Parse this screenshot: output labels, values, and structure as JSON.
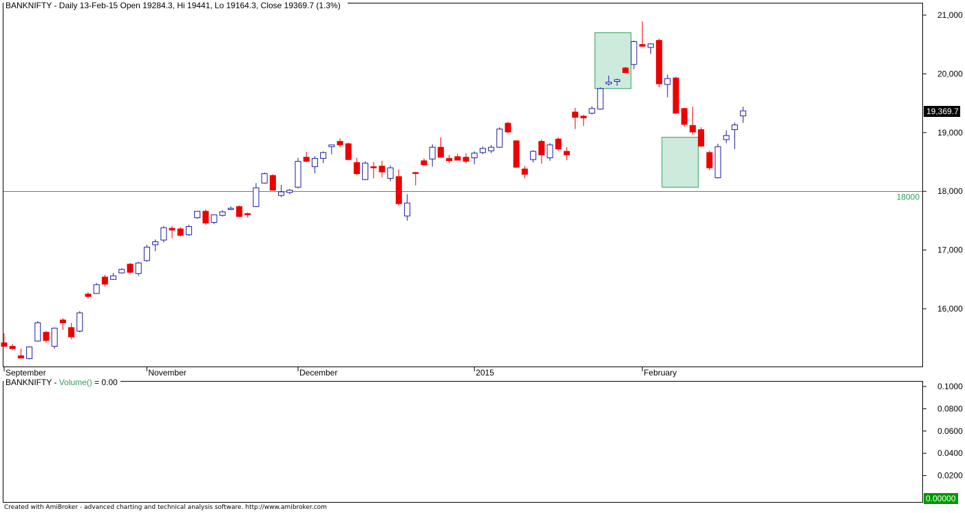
{
  "header": {
    "title": "BANKNIFTY - Daily 13-Feb-15 Open 19284.3, Hi 19441, Lo 19164.3, Close 19369.7 (1.3%)"
  },
  "volume_panel": {
    "label_prefix": "BANKNIFTY - ",
    "indicator": "Volume()",
    "value_text": " = 0.00",
    "last_value_badge": "0.00000"
  },
  "footer": {
    "text": "Created with AmiBroker - advanced charting and technical analysis software. http://www.amibroker.com"
  },
  "colors": {
    "up_candle_border": "#1a1aaa",
    "down_candle": "#ee0000",
    "highlight_box": "#cdebdc",
    "reference_line": "#2e9e5b",
    "last_price_badge_bg": "#000000",
    "volume_badge_bg": "#009900"
  },
  "chart_data": [
    {
      "type": "candlestick",
      "y_range": [
        15000,
        21100
      ],
      "y_ticks": [
        16000,
        17000,
        18000,
        19000,
        20000,
        21000
      ],
      "y_tick_labels": [
        "16,000",
        "17,000",
        "18,000",
        "19,000",
        "20,000",
        "21,000"
      ],
      "x_labels": [
        "September",
        "November",
        "December",
        "2015",
        "February"
      ],
      "x_label_index": [
        0,
        17,
        35,
        56,
        76
      ],
      "last_price_label": "19,369.7",
      "last_price": 19369.7,
      "reference_line": {
        "value": 18000,
        "label": "18000"
      },
      "highlight_boxes": [
        {
          "from_index": 71,
          "to_index": 74,
          "low": 19750,
          "high": 20700
        },
        {
          "from_index": 79,
          "to_index": 82,
          "low": 18070,
          "high": 18920
        }
      ],
      "candles": [
        {
          "o": 15420,
          "h": 15580,
          "l": 15370,
          "c": 15360
        },
        {
          "o": 15360,
          "h": 15400,
          "l": 15300,
          "c": 15320
        },
        {
          "o": 15200,
          "h": 15320,
          "l": 15180,
          "c": 15160
        },
        {
          "o": 15150,
          "h": 15360,
          "l": 15140,
          "c": 15350
        },
        {
          "o": 15450,
          "h": 15790,
          "l": 15440,
          "c": 15760
        },
        {
          "o": 15600,
          "h": 15620,
          "l": 15420,
          "c": 15460
        },
        {
          "o": 15360,
          "h": 15680,
          "l": 15320,
          "c": 15670
        },
        {
          "o": 15810,
          "h": 15840,
          "l": 15640,
          "c": 15760
        },
        {
          "o": 15680,
          "h": 15760,
          "l": 15480,
          "c": 15520
        },
        {
          "o": 15620,
          "h": 15960,
          "l": 15600,
          "c": 15930
        },
        {
          "o": 16250,
          "h": 16280,
          "l": 16180,
          "c": 16210
        },
        {
          "o": 16260,
          "h": 16440,
          "l": 16260,
          "c": 16410
        },
        {
          "o": 16540,
          "h": 16580,
          "l": 16380,
          "c": 16420
        },
        {
          "o": 16500,
          "h": 16610,
          "l": 16490,
          "c": 16560
        },
        {
          "o": 16610,
          "h": 16690,
          "l": 16600,
          "c": 16670
        },
        {
          "o": 16760,
          "h": 16780,
          "l": 16600,
          "c": 16620
        },
        {
          "o": 16600,
          "h": 16800,
          "l": 16560,
          "c": 16780
        },
        {
          "o": 16820,
          "h": 17090,
          "l": 16800,
          "c": 17050
        },
        {
          "o": 17090,
          "h": 17180,
          "l": 16980,
          "c": 17140
        },
        {
          "o": 17170,
          "h": 17410,
          "l": 17130,
          "c": 17380
        },
        {
          "o": 17370,
          "h": 17410,
          "l": 17200,
          "c": 17340
        },
        {
          "o": 17360,
          "h": 17390,
          "l": 17230,
          "c": 17250
        },
        {
          "o": 17260,
          "h": 17430,
          "l": 17240,
          "c": 17400
        },
        {
          "o": 17550,
          "h": 17650,
          "l": 17530,
          "c": 17660
        },
        {
          "o": 17660,
          "h": 17690,
          "l": 17430,
          "c": 17460
        },
        {
          "o": 17470,
          "h": 17600,
          "l": 17440,
          "c": 17600
        },
        {
          "o": 17590,
          "h": 17680,
          "l": 17570,
          "c": 17650
        },
        {
          "o": 17690,
          "h": 17740,
          "l": 17680,
          "c": 17710
        },
        {
          "o": 17740,
          "h": 17760,
          "l": 17560,
          "c": 17570
        },
        {
          "o": 17620,
          "h": 17640,
          "l": 17550,
          "c": 17600
        },
        {
          "o": 17740,
          "h": 18140,
          "l": 17730,
          "c": 18060
        },
        {
          "o": 18140,
          "h": 18320,
          "l": 18130,
          "c": 18300
        },
        {
          "o": 18270,
          "h": 18290,
          "l": 18010,
          "c": 18020
        },
        {
          "o": 17930,
          "h": 18110,
          "l": 17900,
          "c": 17990
        },
        {
          "o": 17980,
          "h": 18040,
          "l": 17950,
          "c": 18020
        },
        {
          "o": 18070,
          "h": 18570,
          "l": 18050,
          "c": 18510
        },
        {
          "o": 18580,
          "h": 18670,
          "l": 18500,
          "c": 18510
        },
        {
          "o": 18420,
          "h": 18600,
          "l": 18310,
          "c": 18560
        },
        {
          "o": 18560,
          "h": 18680,
          "l": 18480,
          "c": 18660
        },
        {
          "o": 18760,
          "h": 18790,
          "l": 18630,
          "c": 18790
        },
        {
          "o": 18850,
          "h": 18900,
          "l": 18750,
          "c": 18790
        },
        {
          "o": 18810,
          "h": 18830,
          "l": 18530,
          "c": 18540
        },
        {
          "o": 18490,
          "h": 18570,
          "l": 18280,
          "c": 18300
        },
        {
          "o": 18200,
          "h": 18510,
          "l": 18190,
          "c": 18480
        },
        {
          "o": 18420,
          "h": 18500,
          "l": 18220,
          "c": 18400
        },
        {
          "o": 18430,
          "h": 18520,
          "l": 18240,
          "c": 18330
        },
        {
          "o": 18220,
          "h": 18440,
          "l": 18170,
          "c": 18400
        },
        {
          "o": 18250,
          "h": 18370,
          "l": 17760,
          "c": 17790
        },
        {
          "o": 17580,
          "h": 17950,
          "l": 17500,
          "c": 17800
        },
        {
          "o": 18320,
          "h": 18330,
          "l": 18100,
          "c": 18310
        },
        {
          "o": 18520,
          "h": 18560,
          "l": 18460,
          "c": 18450
        },
        {
          "o": 18550,
          "h": 18800,
          "l": 18420,
          "c": 18750
        },
        {
          "o": 18750,
          "h": 18920,
          "l": 18580,
          "c": 18580
        },
        {
          "o": 18560,
          "h": 18620,
          "l": 18480,
          "c": 18520
        },
        {
          "o": 18590,
          "h": 18640,
          "l": 18540,
          "c": 18530
        },
        {
          "o": 18580,
          "h": 18650,
          "l": 18470,
          "c": 18510
        },
        {
          "o": 18570,
          "h": 18680,
          "l": 18460,
          "c": 18650
        },
        {
          "o": 18660,
          "h": 18760,
          "l": 18630,
          "c": 18730
        },
        {
          "o": 18690,
          "h": 18790,
          "l": 18650,
          "c": 18750
        },
        {
          "o": 18750,
          "h": 19090,
          "l": 18740,
          "c": 19060
        },
        {
          "o": 19160,
          "h": 19180,
          "l": 18990,
          "c": 19010
        },
        {
          "o": 18860,
          "h": 18870,
          "l": 18400,
          "c": 18410
        },
        {
          "o": 18380,
          "h": 18430,
          "l": 18220,
          "c": 18290
        },
        {
          "o": 18540,
          "h": 18700,
          "l": 18490,
          "c": 18680
        },
        {
          "o": 18850,
          "h": 18880,
          "l": 18470,
          "c": 18620
        },
        {
          "o": 18570,
          "h": 18820,
          "l": 18520,
          "c": 18790
        },
        {
          "o": 18890,
          "h": 18920,
          "l": 18690,
          "c": 18720
        },
        {
          "o": 18680,
          "h": 18750,
          "l": 18530,
          "c": 18620
        },
        {
          "o": 19350,
          "h": 19420,
          "l": 19060,
          "c": 19260
        },
        {
          "o": 19280,
          "h": 19300,
          "l": 19110,
          "c": 19250
        },
        {
          "o": 19330,
          "h": 19450,
          "l": 19310,
          "c": 19410
        },
        {
          "o": 19400,
          "h": 19770,
          "l": 19390,
          "c": 19750
        },
        {
          "o": 19830,
          "h": 19970,
          "l": 19800,
          "c": 19860
        },
        {
          "o": 19870,
          "h": 19920,
          "l": 19800,
          "c": 19900
        },
        {
          "o": 20100,
          "h": 20120,
          "l": 20020,
          "c": 20020
        },
        {
          "o": 20160,
          "h": 20570,
          "l": 20080,
          "c": 20550
        },
        {
          "o": 20500,
          "h": 20890,
          "l": 20460,
          "c": 20470
        },
        {
          "o": 20450,
          "h": 20520,
          "l": 20340,
          "c": 20510
        },
        {
          "o": 20570,
          "h": 20600,
          "l": 19770,
          "c": 19830
        },
        {
          "o": 19820,
          "h": 19990,
          "l": 19600,
          "c": 19920
        },
        {
          "o": 19930,
          "h": 19950,
          "l": 19320,
          "c": 19330
        },
        {
          "o": 19410,
          "h": 19420,
          "l": 19100,
          "c": 19140
        },
        {
          "o": 19120,
          "h": 19440,
          "l": 18970,
          "c": 19010
        },
        {
          "o": 19050,
          "h": 19090,
          "l": 18750,
          "c": 18770
        },
        {
          "o": 18660,
          "h": 18690,
          "l": 18360,
          "c": 18400
        },
        {
          "o": 18230,
          "h": 18810,
          "l": 18220,
          "c": 18760
        },
        {
          "o": 18880,
          "h": 19040,
          "l": 18820,
          "c": 18950
        },
        {
          "o": 19050,
          "h": 19170,
          "l": 18720,
          "c": 19130
        },
        {
          "o": 19284.3,
          "h": 19441,
          "l": 19164.3,
          "c": 19369.7
        }
      ]
    },
    {
      "type": "bar",
      "name_label": "Volume()",
      "y_range": [
        0,
        0.1
      ],
      "y_ticks": [
        0,
        0.02,
        0.04,
        0.06,
        0.08,
        0.1
      ],
      "y_tick_labels": [
        "0.0000",
        "0.0200",
        "0.0400",
        "0.0600",
        "0.0800",
        "0.1000"
      ],
      "values": []
    }
  ]
}
